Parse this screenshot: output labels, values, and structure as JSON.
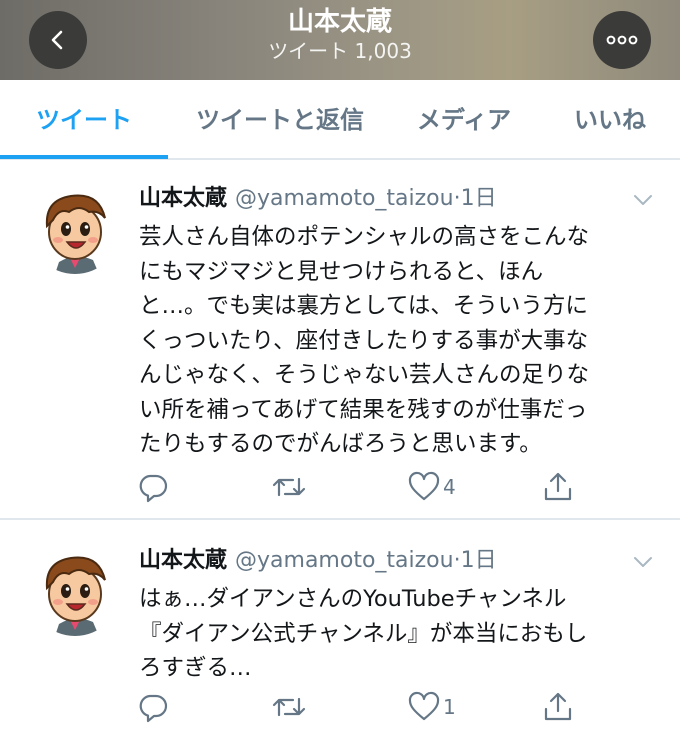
{
  "header": {
    "title": "山本太蔵",
    "subtitle": "ツイート 1,003"
  },
  "tabs": [
    {
      "label": "ツイート",
      "active": true
    },
    {
      "label": "ツイートと返信",
      "active": false
    },
    {
      "label": "メディア",
      "active": false
    },
    {
      "label": "いいね",
      "active": false
    }
  ],
  "tweets": [
    {
      "name": "山本太蔵",
      "handle": "@yamamoto_taizou",
      "time": "1日",
      "text": "芸人さん自体のポテンシャルの高さをこんな\nにもマジマジと見せつけられると、ほん\nと…。でも実は裏方としては、そういう方に\nくっついたり、座付きしたりする事が大事な\nんじゃなく、そうじゃない芸人さんの足りな\nい所を補ってあげて結果を残すのが仕事だっ\nたりもするのでがんばろうと思います。",
      "likes": "4"
    },
    {
      "name": "山本太蔵",
      "handle": "@yamamoto_taizou",
      "time": "1日",
      "text": "はぁ…ダイアンさんのYouTubeチャンネル\n『ダイアン公式チャンネル』が本当におもし\nろすぎる…",
      "likes": "1"
    }
  ],
  "colors": {
    "accent": "#1da1f2",
    "secondary_text": "#657786",
    "divider": "#e1e8ed"
  },
  "icons": [
    "back-arrow-icon",
    "more-options-icon",
    "chevron-down-icon",
    "reply-icon",
    "retweet-icon",
    "like-icon",
    "share-icon"
  ]
}
